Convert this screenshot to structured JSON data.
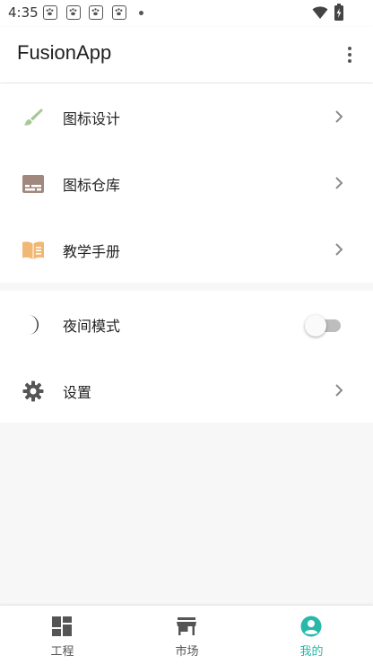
{
  "status_bar": {
    "time": "4:35"
  },
  "app": {
    "title": "FusionApp"
  },
  "menu_group1": [
    {
      "label": "图标设计",
      "icon": "brush-icon"
    },
    {
      "label": "图标仓库",
      "icon": "subtitles-icon"
    },
    {
      "label": "教学手册",
      "icon": "book-icon"
    }
  ],
  "menu_group2": [
    {
      "label": "夜间模式",
      "icon": "moon-icon",
      "toggle": false
    },
    {
      "label": "设置",
      "icon": "gear-icon"
    }
  ],
  "bottom_nav": [
    {
      "label": "工程",
      "icon": "dashboard-icon",
      "active": false
    },
    {
      "label": "市场",
      "icon": "store-icon",
      "active": false
    },
    {
      "label": "我的",
      "icon": "account-circle-icon",
      "active": true
    }
  ],
  "colors": {
    "accent": "#26b8a8",
    "brush": "#a8c896",
    "ticket": "#a1887f",
    "book": "#f0b775"
  }
}
